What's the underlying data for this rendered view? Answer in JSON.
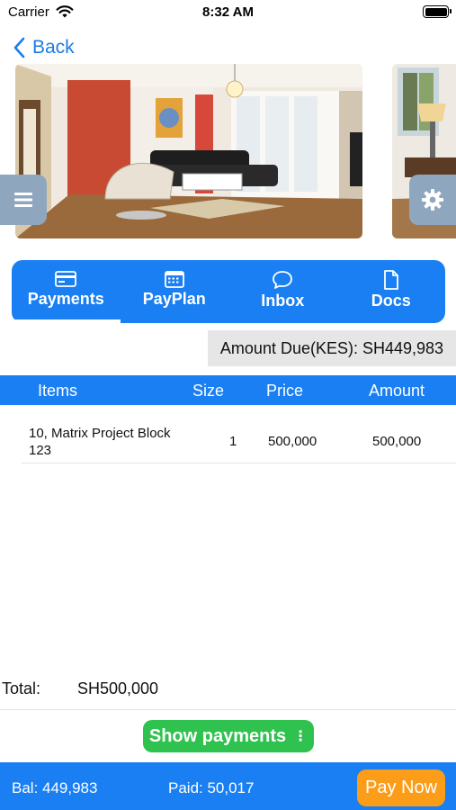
{
  "status_bar": {
    "carrier": "Carrier",
    "time": "8:32 AM"
  },
  "nav": {
    "back_label": "Back"
  },
  "tabs": [
    {
      "label": "Payments",
      "icon": "card-icon",
      "active": true
    },
    {
      "label": "PayPlan",
      "icon": "calendar-icon",
      "active": false
    },
    {
      "label": "Inbox",
      "icon": "chat-bubble-icon",
      "active": false
    },
    {
      "label": "Docs",
      "icon": "document-icon",
      "active": false
    }
  ],
  "amount_due": "Amount Due(KES): SH449,983",
  "table": {
    "headers": [
      "Items",
      "Size",
      "Price",
      "Amount"
    ],
    "rows": [
      {
        "item": "10, Matrix Project Block 123",
        "size": "1",
        "price": "500,000",
        "amount": "500,000"
      }
    ]
  },
  "total": {
    "label": "Total:",
    "value": "SH500,000"
  },
  "show_payments_label": "Show payments",
  "bottom_bar": {
    "bal": "Bal: 449,983",
    "paid": "Paid: 50,017",
    "pay_now_label": "Pay Now"
  },
  "colors": {
    "primary_blue": "#1a7ff2",
    "link_blue": "#1a7de6",
    "success_green": "#2fc24f",
    "pay_orange": "#fb9d18",
    "side_button_gray": "#8fa6bf"
  }
}
